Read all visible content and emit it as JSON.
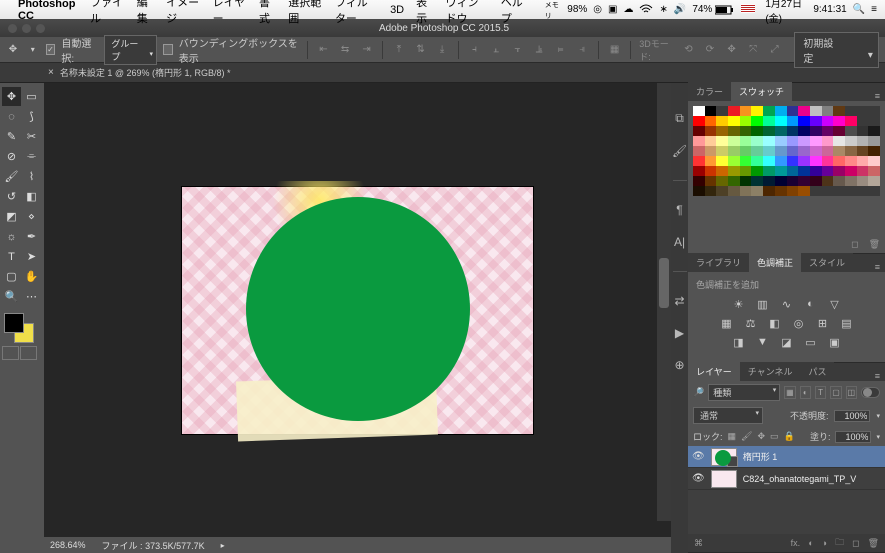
{
  "mac_menu": {
    "app": "Photoshop CC",
    "items": [
      "ファイル",
      "編集",
      "イメージ",
      "レイヤー",
      "書式",
      "選択範囲",
      "フィルター",
      "3D",
      "表示",
      "ウィンドウ",
      "ヘルプ"
    ],
    "mem_label": "メモリ",
    "mem_pct": "98%",
    "battery": "74%",
    "date": "1月27日(金)",
    "time": "9:41:31"
  },
  "window_title": "Adobe Photoshop CC 2015.5",
  "options": {
    "auto_select_label": "自動選択:",
    "auto_select_value": "グループ",
    "show_bbox_label": "バウンディングボックスを表示",
    "mode3d_label": "3Dモード:",
    "preset_label": "初期設定"
  },
  "doc_tab": "名称未設定 1 @ 269% (楕円形 1, RGB/8) *",
  "status": {
    "zoom": "268.64%",
    "filesize_label": "ファイル :",
    "filesize": "373.5K/577.7K"
  },
  "panels": {
    "color_tabs": [
      "カラー",
      "スウォッチ"
    ],
    "adjust_tabs": [
      "ライブラリ",
      "色調補正",
      "スタイル"
    ],
    "adjust_hint": "色調補正を追加",
    "layer_tabs": [
      "レイヤー",
      "チャンネル",
      "パス"
    ],
    "filter_kind": "種類",
    "blend_mode": "通常",
    "opacity_label": "不透明度:",
    "opacity_value": "100%",
    "lock_label": "ロック:",
    "fill_label": "塗り:",
    "fill_value": "100%",
    "layers": [
      {
        "name": "楕円形 1",
        "selected": true,
        "kind": "ellipse"
      },
      {
        "name": "C824_ohanatotegami_TP_V",
        "selected": false,
        "kind": "image"
      }
    ]
  },
  "swatch_colors": [
    "#ffffff",
    "#000000",
    "#3a3a3a",
    "#ed1c24",
    "#f7931e",
    "#fff200",
    "#00a651",
    "#00aeef",
    "#2e3192",
    "#ed008c",
    "#c0c0c0",
    "#808080",
    "#603913",
    "#3a3a3a",
    "#3a3a3a",
    "#3a3a3a",
    "#ff0000",
    "#ff6600",
    "#ffcc00",
    "#ffff00",
    "#99ff00",
    "#00ff00",
    "#00ff99",
    "#00ffff",
    "#0099ff",
    "#0000ff",
    "#6600ff",
    "#cc00ff",
    "#ff00cc",
    "#ff0066",
    "#3a3a3a",
    "#3a3a3a",
    "#660000",
    "#993300",
    "#996600",
    "#666600",
    "#336600",
    "#006600",
    "#006633",
    "#006666",
    "#003366",
    "#000066",
    "#330066",
    "#660066",
    "#660033",
    "#4d4d4d",
    "#333333",
    "#1a1a1a",
    "#ff9999",
    "#ffcc99",
    "#ffff99",
    "#ccff99",
    "#99ff99",
    "#99ffcc",
    "#99ffff",
    "#99ccff",
    "#9999ff",
    "#cc99ff",
    "#ff99ff",
    "#ff99cc",
    "#e6e6e6",
    "#cccccc",
    "#b3b3b3",
    "#999999",
    "#cc6666",
    "#cc9966",
    "#cccc66",
    "#99cc66",
    "#66cc66",
    "#66cc99",
    "#66cccc",
    "#6699cc",
    "#6666cc",
    "#9966cc",
    "#cc66cc",
    "#cc6699",
    "#aa8866",
    "#886644",
    "#664422",
    "#442200",
    "#ff3333",
    "#ff9933",
    "#ffff33",
    "#99ff33",
    "#33ff33",
    "#33ff99",
    "#33ffff",
    "#3399ff",
    "#3333ff",
    "#9933ff",
    "#ff33ff",
    "#ff3399",
    "#ff6666",
    "#ff8888",
    "#ffaaaa",
    "#ffcccc",
    "#990000",
    "#cc3300",
    "#cc6600",
    "#999900",
    "#669900",
    "#009900",
    "#009966",
    "#009999",
    "#006699",
    "#003399",
    "#330099",
    "#660099",
    "#990066",
    "#cc0066",
    "#cc3366",
    "#cc6666",
    "#330000",
    "#663300",
    "#666600",
    "#336600",
    "#003300",
    "#003333",
    "#001a33",
    "#000033",
    "#1a0033",
    "#330033",
    "#33001a",
    "#4d3319",
    "#66594d",
    "#807366",
    "#998c80",
    "#b3a699",
    "#1a0d00",
    "#33260d",
    "#4d4026",
    "#665940",
    "#807359",
    "#8c8066",
    "#4d2600",
    "#663300",
    "#804000",
    "#994d00",
    "#3a3a3a",
    "#3a3a3a",
    "#3a3a3a",
    "#3a3a3a",
    "#3a3a3a",
    "#3a3a3a"
  ]
}
